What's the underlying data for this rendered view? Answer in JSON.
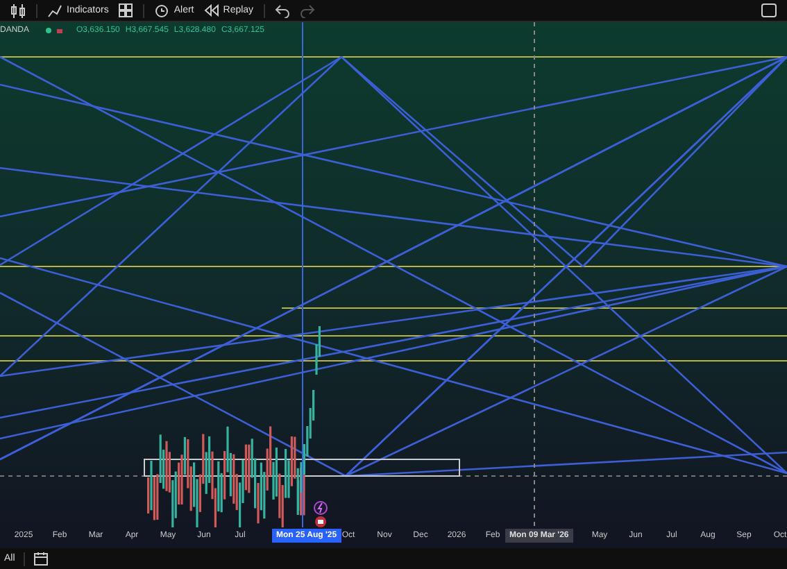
{
  "toolbar": {
    "indicators": "Indicators",
    "alert": "Alert",
    "replay": "Replay",
    "redo_disabled": true
  },
  "legend": {
    "symbol": "DANDA",
    "open": "O3,636.150",
    "high": "H3,667.545",
    "low": "L3,628.480",
    "close": "C3,667.125"
  },
  "time_axis": {
    "segments": [
      [
        "2025",
        "Feb",
        "Mar",
        "Apr",
        "May",
        "Jun",
        "Jul"
      ],
      [
        "Oct",
        "Nov",
        "Dec",
        "2026",
        "Feb"
      ],
      [
        "May",
        "Jun",
        "Jul",
        "Aug",
        "Sep",
        "Oct"
      ]
    ],
    "crosshair_label": "Mon 25 Aug '25",
    "cursor_label": "Mon 09 Mar '26"
  },
  "bottom_bar": {
    "range": "All"
  }
}
